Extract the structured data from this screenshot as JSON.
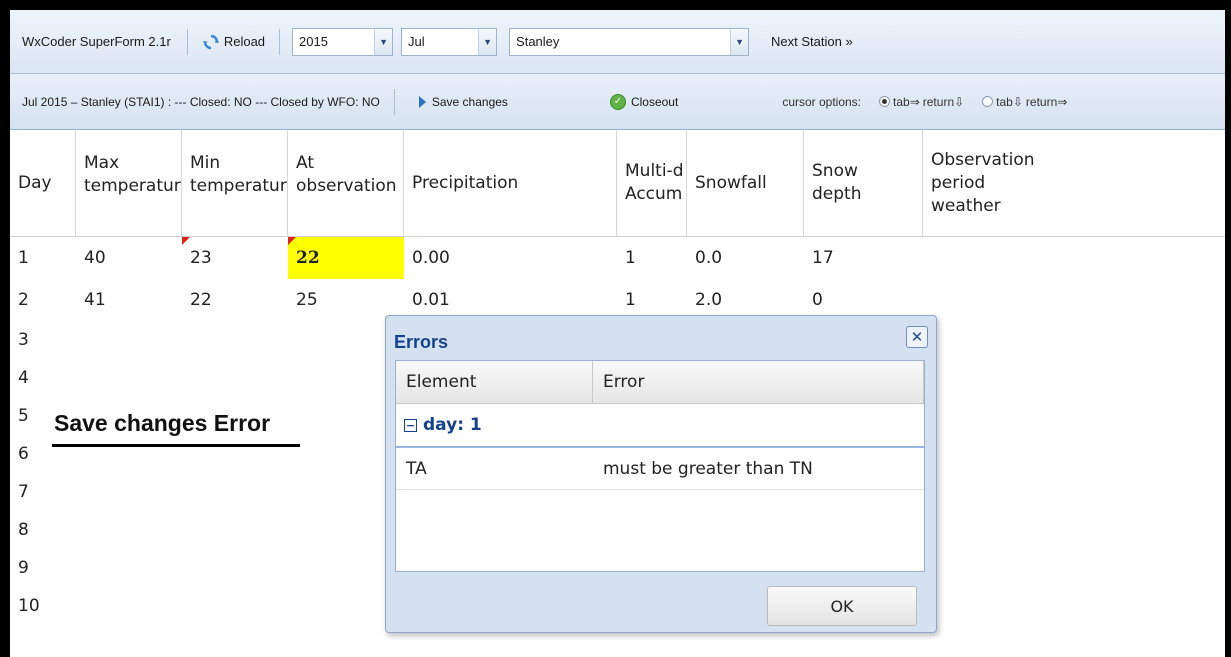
{
  "toolbar": {
    "app_title": "WxCoder SuperForm 2.1r",
    "reload_label": "Reload",
    "year_value": "2015",
    "month_value": "Jul",
    "station_value": "Stanley",
    "next_station_label": "Next Station »"
  },
  "statusbar": {
    "status_text": "Jul 2015 – Stanley (STAI1) : --- Closed: NO --- Closed by WFO: NO",
    "save_label": "Save changes",
    "closeout_label": "Closeout",
    "cursor_label": "cursor options:",
    "opt1_a": "tab⇒",
    "opt1_b": "return⇩",
    "opt2_a": "tab⇩",
    "opt2_b": "return⇒"
  },
  "grid": {
    "headers": {
      "day": "Day",
      "max_1": "Max",
      "max_2": "temperature",
      "min_1": "Min",
      "min_2": "temperature",
      "at_1": "At",
      "at_2": "observation",
      "precip": "Precipitation",
      "multi_1": "Multi-d",
      "multi_2": "Accum",
      "snowfall": "Snowfall",
      "depth_1": "Snow",
      "depth_2": "depth",
      "obs_1": "Observation",
      "obs_2": "period",
      "obs_3": "weather"
    },
    "rows": [
      {
        "day": "1",
        "max": "40",
        "min": "23",
        "at": "22",
        "precip": "0.00",
        "multi": "1",
        "snow": "0.0",
        "depth": "17"
      },
      {
        "day": "2",
        "max": "41",
        "min": "22",
        "at": "25",
        "precip": "0.01",
        "multi": "1",
        "snow": "2.0",
        "depth": "0"
      },
      {
        "day": "3"
      },
      {
        "day": "4"
      },
      {
        "day": "5"
      },
      {
        "day": "6"
      },
      {
        "day": "7"
      },
      {
        "day": "8"
      },
      {
        "day": "9"
      },
      {
        "day": "10"
      }
    ]
  },
  "annotation": "Save changes Error",
  "dialog": {
    "title": "Errors",
    "col_element": "Element",
    "col_error": "Error",
    "group_label": "day: 1",
    "errors": [
      {
        "element": "TA",
        "message": "must be greater than TN"
      }
    ],
    "ok_label": "OK"
  },
  "colors": {
    "highlight": "#ffff00",
    "error_flag": "#e0221b",
    "dialog_title": "#15428b"
  },
  "icons": [
    "reload-icon",
    "chevron-down-icon",
    "play-icon",
    "check-circle-icon",
    "close-icon",
    "collapse-icon"
  ]
}
